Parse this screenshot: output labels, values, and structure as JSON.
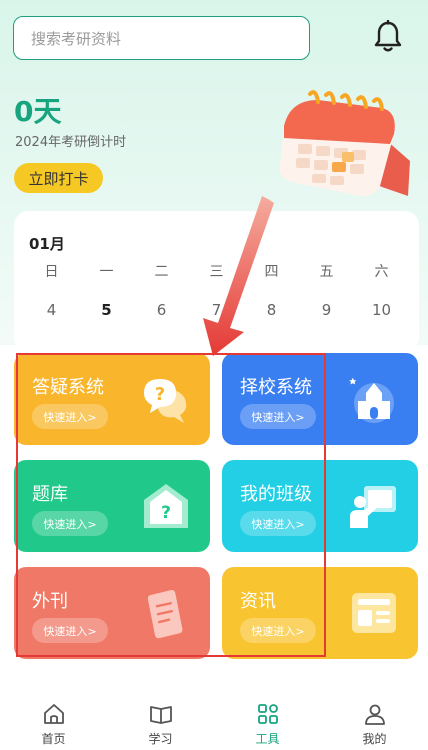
{
  "search": {
    "placeholder": "搜索考研资料"
  },
  "countdown": {
    "days": "0天",
    "subtitle": "2024年考研倒计时",
    "checkin_label": "立即打卡"
  },
  "calendar": {
    "month": "01月",
    "weekdays": [
      "日",
      "一",
      "二",
      "三",
      "四",
      "五",
      "六"
    ],
    "dates": [
      "4",
      "5",
      "6",
      "7",
      "8",
      "9",
      "10"
    ],
    "today": "5"
  },
  "tools": [
    {
      "title": "答疑系统",
      "button": "快速进入>",
      "icon": "qa-bubble-icon",
      "color": "#f9b62d"
    },
    {
      "title": "择校系统",
      "button": "快速进入>",
      "icon": "school-building-icon",
      "color": "#3a7ff2"
    },
    {
      "title": "题库",
      "button": "快速进入>",
      "icon": "question-house-icon",
      "color": "#20c98a"
    },
    {
      "title": "我的班级",
      "button": "快速进入>",
      "icon": "teacher-board-icon",
      "color": "#22cfe4"
    },
    {
      "title": "外刊",
      "button": "快速进入>",
      "icon": "magazine-icon",
      "color": "#f07867"
    },
    {
      "title": "资讯",
      "button": "快速进入>",
      "icon": "news-card-icon",
      "color": "#f8c430"
    }
  ],
  "tabbar": [
    {
      "label": "首页",
      "icon": "home-icon",
      "active": false
    },
    {
      "label": "学习",
      "icon": "book-icon",
      "active": false
    },
    {
      "label": "工具",
      "icon": "grid-tools-icon",
      "active": true
    },
    {
      "label": "我的",
      "icon": "user-icon",
      "active": false
    }
  ],
  "colors": {
    "accent": "#17a47e",
    "annotation_red": "#e53935",
    "checkin_yellow": "#f6c823"
  }
}
